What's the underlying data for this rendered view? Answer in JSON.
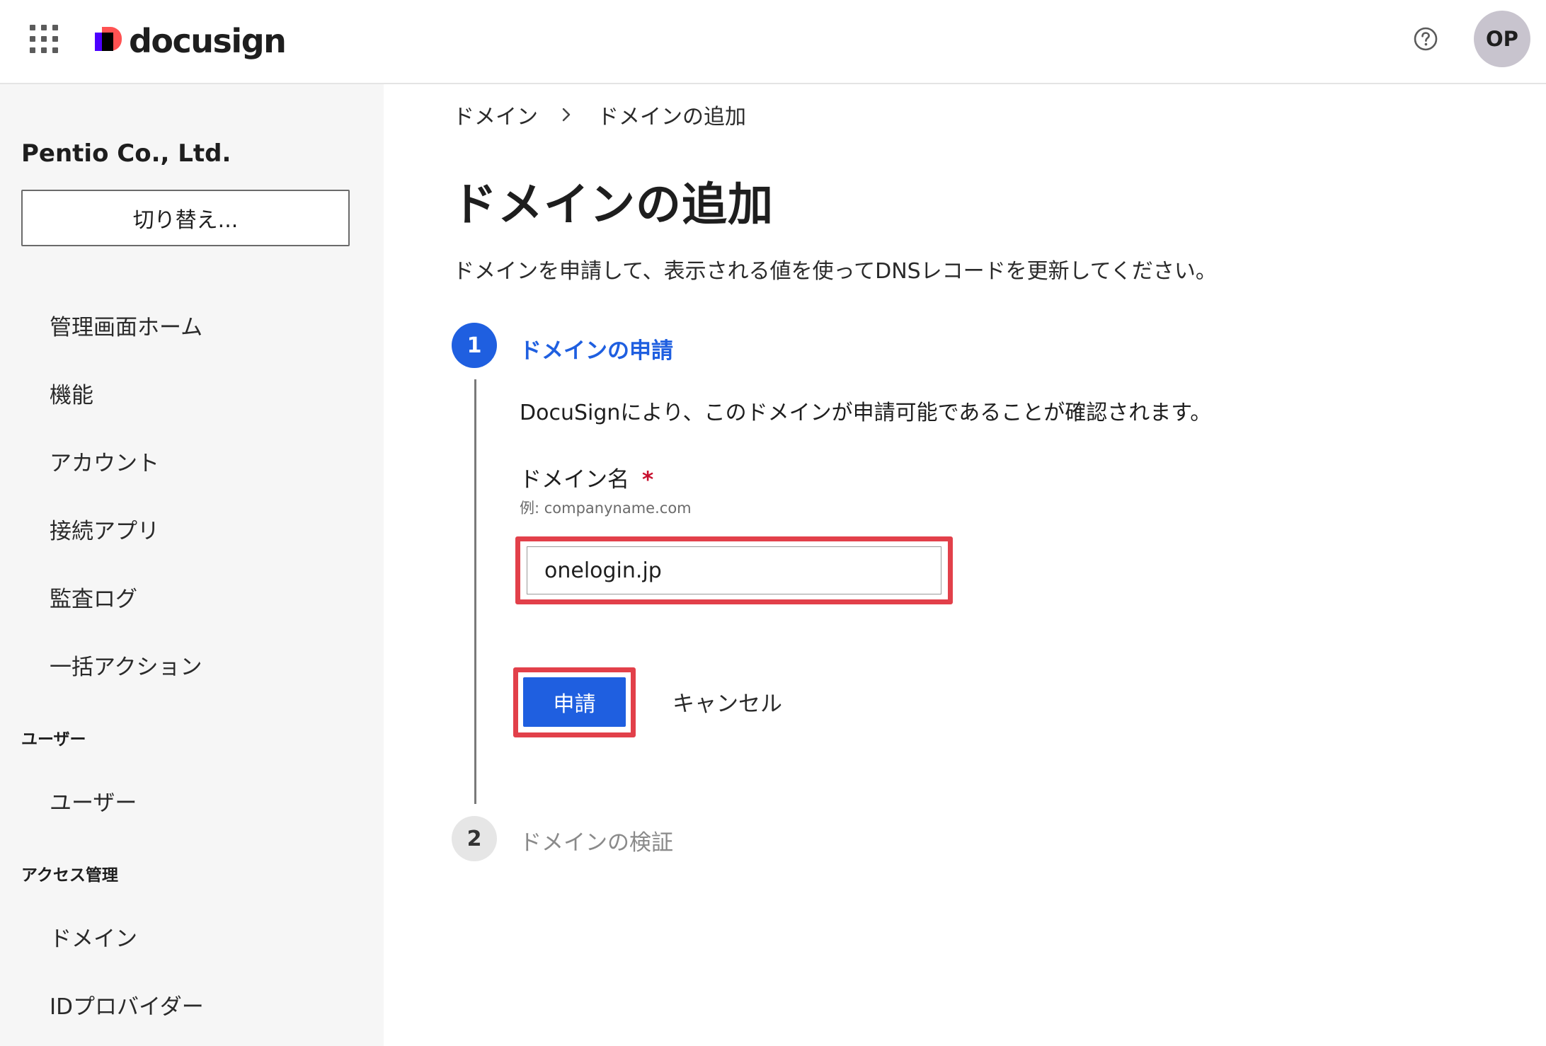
{
  "topbar": {
    "logo_text": "docusign",
    "avatar_initials": "OP",
    "icons": {
      "apps": "grid-icon",
      "help": "help-circle-icon"
    },
    "colors": {
      "brand_purple": "#4c00ff",
      "brand_coral": "#ff5252"
    }
  },
  "sidebar": {
    "org_name": "Pentio Co., Ltd.",
    "switch_label": "切り替え...",
    "items": [
      {
        "label": "管理画面ホーム"
      },
      {
        "label": "機能"
      },
      {
        "label": "アカウント"
      },
      {
        "label": "接続アプリ"
      },
      {
        "label": "監査ログ"
      },
      {
        "label": "一括アクション"
      }
    ],
    "sections": [
      {
        "title": "ユーザー",
        "items": [
          {
            "label": "ユーザー"
          }
        ]
      },
      {
        "title": "アクセス管理",
        "items": [
          {
            "label": "ドメイン"
          },
          {
            "label": "IDプロバイダー"
          }
        ]
      }
    ]
  },
  "main": {
    "breadcrumb": {
      "parent": "ドメイン",
      "current": "ドメインの追加"
    },
    "title": "ドメインの追加",
    "description": "ドメインを申請して、表示される値を使ってDNSレコードを更新してください。",
    "steps": [
      {
        "number": "1",
        "title": "ドメインの申請",
        "state": "active"
      },
      {
        "number": "2",
        "title": "ドメインの検証",
        "state": "inactive"
      }
    ],
    "step1": {
      "description": "DocuSignにより、このドメインが申請可能であることが確認されます。",
      "field_label": "ドメイン名",
      "required_mark": "*",
      "hint": "例: companyname.com",
      "input_value": "onelogin.jp",
      "apply_label": "申請",
      "cancel_label": "キャンセル"
    },
    "colors": {
      "accent": "#1f5fe0",
      "highlight": "#e2404a",
      "required": "#c8102e"
    }
  }
}
